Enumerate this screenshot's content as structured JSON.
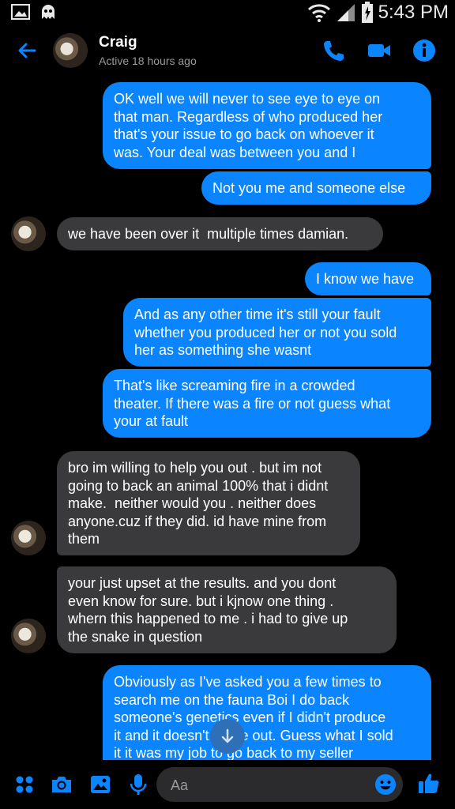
{
  "status_bar": {
    "time": "5:43 PM"
  },
  "header": {
    "name": "Craig",
    "status": "Active 18 hours ago"
  },
  "messages": [
    {
      "dir": "out",
      "lines": [
        "OK well we will never to see eye to eye on",
        "that man. Regardless of who produced her",
        "that's your issue to go back on whoever it",
        "was. Your deal was between you and I"
      ]
    },
    {
      "dir": "out",
      "lines": [
        "Not you me and someone else"
      ]
    },
    {
      "dir": "in",
      "lines": [
        "we have been over it  multiple times damian."
      ]
    },
    {
      "dir": "out",
      "lines": [
        "I know we have"
      ]
    },
    {
      "dir": "out",
      "lines": [
        "And as any other time it's still your fault",
        "whether you produced her or not you sold",
        "her as something she wasnt"
      ]
    },
    {
      "dir": "out",
      "lines": [
        "That's like screaming fire in a crowded",
        "theater. If there was a fire or not guess what",
        "your at fault"
      ]
    },
    {
      "dir": "in",
      "lines": [
        "bro im willing to help you out . but im not",
        "going to back an animal 100% that i didnt",
        "make.  neither would you . neither does",
        "anyone.cuz if they did. id have mine from",
        "them"
      ]
    },
    {
      "dir": "in",
      "lines": [
        "your just upset at the results. and you dont",
        "even know for sure. but i kjnow one thing .",
        "whern this happened to me . i had to give up",
        "the snake in question"
      ]
    },
    {
      "dir": "out",
      "lines": [
        "Obviously as I've asked you a few times to",
        "search me on the fauna Boi I do back",
        "someone's genetics even if I didn't produce",
        "it and it doesn't prove out. Guess what I sold",
        "it it was my job to go back to my seller"
      ]
    }
  ],
  "composer": {
    "placeholder": "Aa"
  },
  "colors": {
    "outgoing": "#0a84ff",
    "incoming": "#3a3a3c",
    "accent": "#0a84ff"
  },
  "icons": [
    "back-arrow-icon",
    "phone-icon",
    "video-camera-icon",
    "info-icon",
    "menu-dots-icon",
    "camera-icon",
    "gallery-icon",
    "microphone-icon",
    "emoji-icon",
    "like-thumb-icon",
    "scroll-down-arrow-icon"
  ]
}
